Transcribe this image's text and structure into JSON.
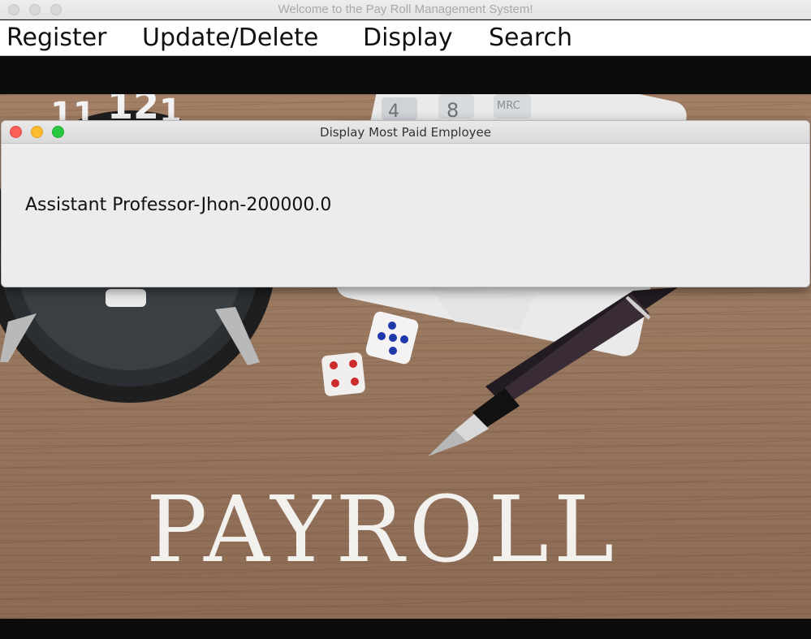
{
  "window": {
    "title": "Welcome to the Pay Roll Management System!"
  },
  "menu": {
    "items": [
      {
        "label": "Register"
      },
      {
        "label": "Update/Delete"
      },
      {
        "label": "Display"
      },
      {
        "label": "Search"
      }
    ]
  },
  "background": {
    "banner_text": "PAYROLL",
    "clock_numbers": [
      "11",
      "12",
      "1"
    ],
    "calculator_keys": [
      "4",
      "8",
      "MRC"
    ]
  },
  "dialog": {
    "title": "Display Most Paid Employee",
    "result_text": "Assistant Professor-Jhon-200000.0"
  },
  "colors": {
    "close": "#fc5f57",
    "minimize": "#fdbc2e",
    "maximize": "#28c840"
  }
}
